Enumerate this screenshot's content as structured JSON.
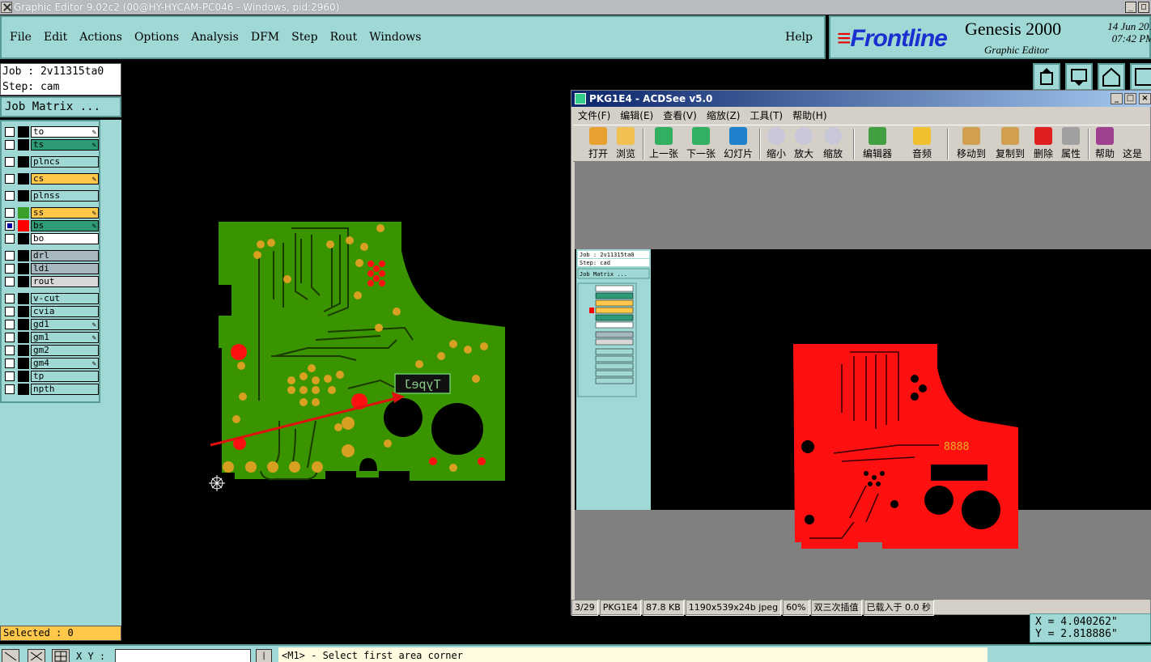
{
  "app": {
    "title": "Graphic Editor 9.02c2 (00@HY-HYCAM-PC046 - Windows, pid:2960)"
  },
  "menu": {
    "items": [
      "File",
      "Edit",
      "Actions",
      "Options",
      "Analysis",
      "DFM",
      "Step",
      "Rout",
      "Windows"
    ],
    "help": "Help"
  },
  "brand": {
    "logo": "Frontline",
    "product": "Genesis 2000",
    "subtitle": "Graphic Editor",
    "date": "14 Jun 201",
    "time": "07:42 PM"
  },
  "job": {
    "job_line": "Job : 2v11315ta0",
    "step_line": "Step: cam",
    "matrix_label": "Job Matrix ..."
  },
  "layers": [
    {
      "name": "to",
      "color": "#ffffff",
      "swatch": "#000000",
      "checked": false,
      "pen": true
    },
    {
      "name": "ts",
      "color": "#2e9a78",
      "swatch": "#000000",
      "checked": false,
      "pen": true
    },
    {
      "name": "plncs",
      "color": "#9fd8d4",
      "swatch": "#000000",
      "checked": false,
      "pen": false
    },
    {
      "name": "cs",
      "color": "#ffc84a",
      "swatch": "#000000",
      "checked": false,
      "pen": true
    },
    {
      "name": "plnss",
      "color": "#9fd8d4",
      "swatch": "#000000",
      "checked": false,
      "pen": false
    },
    {
      "name": "ss",
      "color": "#ffc84a",
      "swatch": "#3aa02a",
      "checked": false,
      "pen": true
    },
    {
      "name": "bs",
      "color": "#2e9a78",
      "swatch": "#ff0000",
      "checked": true,
      "pen": true
    },
    {
      "name": "bo",
      "color": "#ffffff",
      "swatch": "#000000",
      "checked": false,
      "pen": false
    },
    {
      "name": "drl",
      "color": "#a8b8c0",
      "swatch": "#000000",
      "checked": false,
      "pen": false
    },
    {
      "name": "ldi",
      "color": "#a8b8c0",
      "swatch": "#000000",
      "checked": false,
      "pen": false
    },
    {
      "name": "rout",
      "color": "#d8d8d8",
      "swatch": "#000000",
      "checked": false,
      "pen": false
    },
    {
      "name": "v-cut",
      "color": "#9fd8d4",
      "swatch": "#000000",
      "checked": false,
      "pen": false
    },
    {
      "name": "cvia",
      "color": "#9fd8d4",
      "swatch": "#000000",
      "checked": false,
      "pen": false
    },
    {
      "name": "gd1",
      "color": "#9fd8d4",
      "swatch": "#000000",
      "checked": false,
      "pen": true
    },
    {
      "name": "gm1",
      "color": "#9fd8d4",
      "swatch": "#000000",
      "checked": false,
      "pen": true
    },
    {
      "name": "gm2",
      "color": "#9fd8d4",
      "swatch": "#000000",
      "checked": false,
      "pen": false
    },
    {
      "name": "gm4",
      "color": "#9fd8d4",
      "swatch": "#000000",
      "checked": false,
      "pen": true
    },
    {
      "name": "tp",
      "color": "#9fd8d4",
      "swatch": "#000000",
      "checked": false,
      "pen": false
    },
    {
      "name": "npth",
      "color": "#9fd8d4",
      "swatch": "#000000",
      "checked": false,
      "pen": false
    }
  ],
  "selected": "Selected : 0",
  "status": {
    "xy_label": "X Y :",
    "xy_value": "",
    "hint": "<M1> - Select first area corner",
    "x_readout": "X = 4.040262\"",
    "y_readout": "Y = 2.818886\""
  },
  "board": {
    "label_text": "TypeJ"
  },
  "acdsee": {
    "title": "PKG1E4 - ACDSee v5.0",
    "menu": [
      "文件(F)",
      "编辑(E)",
      "查看(V)",
      "缩放(Z)",
      "工具(T)",
      "帮助(H)"
    ],
    "tools": [
      "打开",
      "浏览",
      "上一张",
      "下一张",
      "幻灯片",
      "缩小",
      "放大",
      "缩放",
      "编辑器",
      "音频",
      "移动到",
      "复制到",
      "删除",
      "属性",
      "帮助",
      "这是"
    ],
    "status": [
      "3/29",
      "PKG1E4",
      "87.8 KB",
      "1190x539x24b jpeg",
      "60%",
      "双三次插值",
      "已载入于 0.0 秒"
    ],
    "inner_job": "Job : 2v11315ta0",
    "inner_step": "Step: cad",
    "inner_matrix": "Job Matrix ...",
    "board_label": "8888"
  },
  "colors": {
    "panel": "#9fd8d4",
    "board_green": "#3a9400",
    "pad": "#d8a020",
    "red": "#ff1010"
  }
}
